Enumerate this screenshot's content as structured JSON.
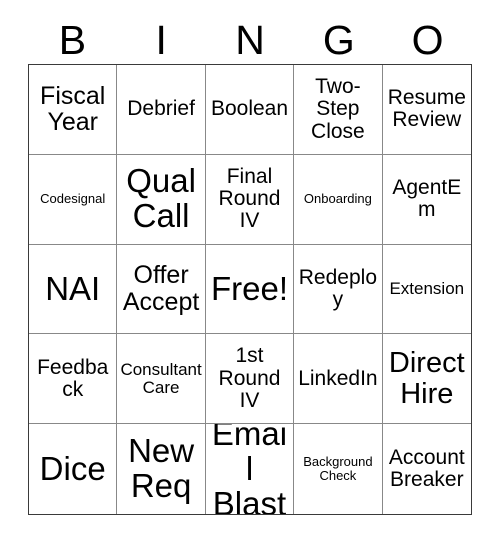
{
  "card": {
    "title": "BINGO",
    "header_letters": [
      "B",
      "I",
      "N",
      "G",
      "O"
    ],
    "colors": {
      "text": "#000000",
      "background": "#ffffff",
      "grid_line": "#888888",
      "outer_border": "#3a3a3a"
    },
    "rows": 5,
    "columns": 5,
    "free_space_index": 12,
    "cells": [
      {
        "text": "Fiscal Year",
        "size": "lg"
      },
      {
        "text": "Debrief",
        "size": "md"
      },
      {
        "text": "Boolean",
        "size": "md"
      },
      {
        "text": "Two-Step Close",
        "size": "md"
      },
      {
        "text": "Resume Review",
        "size": "md"
      },
      {
        "text": "Codesignal",
        "size": "xs"
      },
      {
        "text": "Qual Call",
        "size": "xxl"
      },
      {
        "text": "Final Round IV",
        "size": "md"
      },
      {
        "text": "Onboarding",
        "size": "xs"
      },
      {
        "text": "AgentEm",
        "size": "md"
      },
      {
        "text": "NAI",
        "size": "xxl"
      },
      {
        "text": "Offer Accept",
        "size": "lg"
      },
      {
        "text": "Free!",
        "size": "xxl"
      },
      {
        "text": "Redeploy",
        "size": "md"
      },
      {
        "text": "Extension",
        "size": "sm"
      },
      {
        "text": "Feedback",
        "size": "md"
      },
      {
        "text": "Consultant Care",
        "size": "sm"
      },
      {
        "text": "1st Round IV",
        "size": "md"
      },
      {
        "text": "LinkedIn",
        "size": "md"
      },
      {
        "text": "Direct Hire",
        "size": "xl"
      },
      {
        "text": "Dice",
        "size": "xxl"
      },
      {
        "text": "New Req",
        "size": "xxl"
      },
      {
        "text": "Email Blast",
        "size": "xxl"
      },
      {
        "text": "Background Check",
        "size": "xs"
      },
      {
        "text": "Account Breaker",
        "size": "md"
      }
    ]
  }
}
